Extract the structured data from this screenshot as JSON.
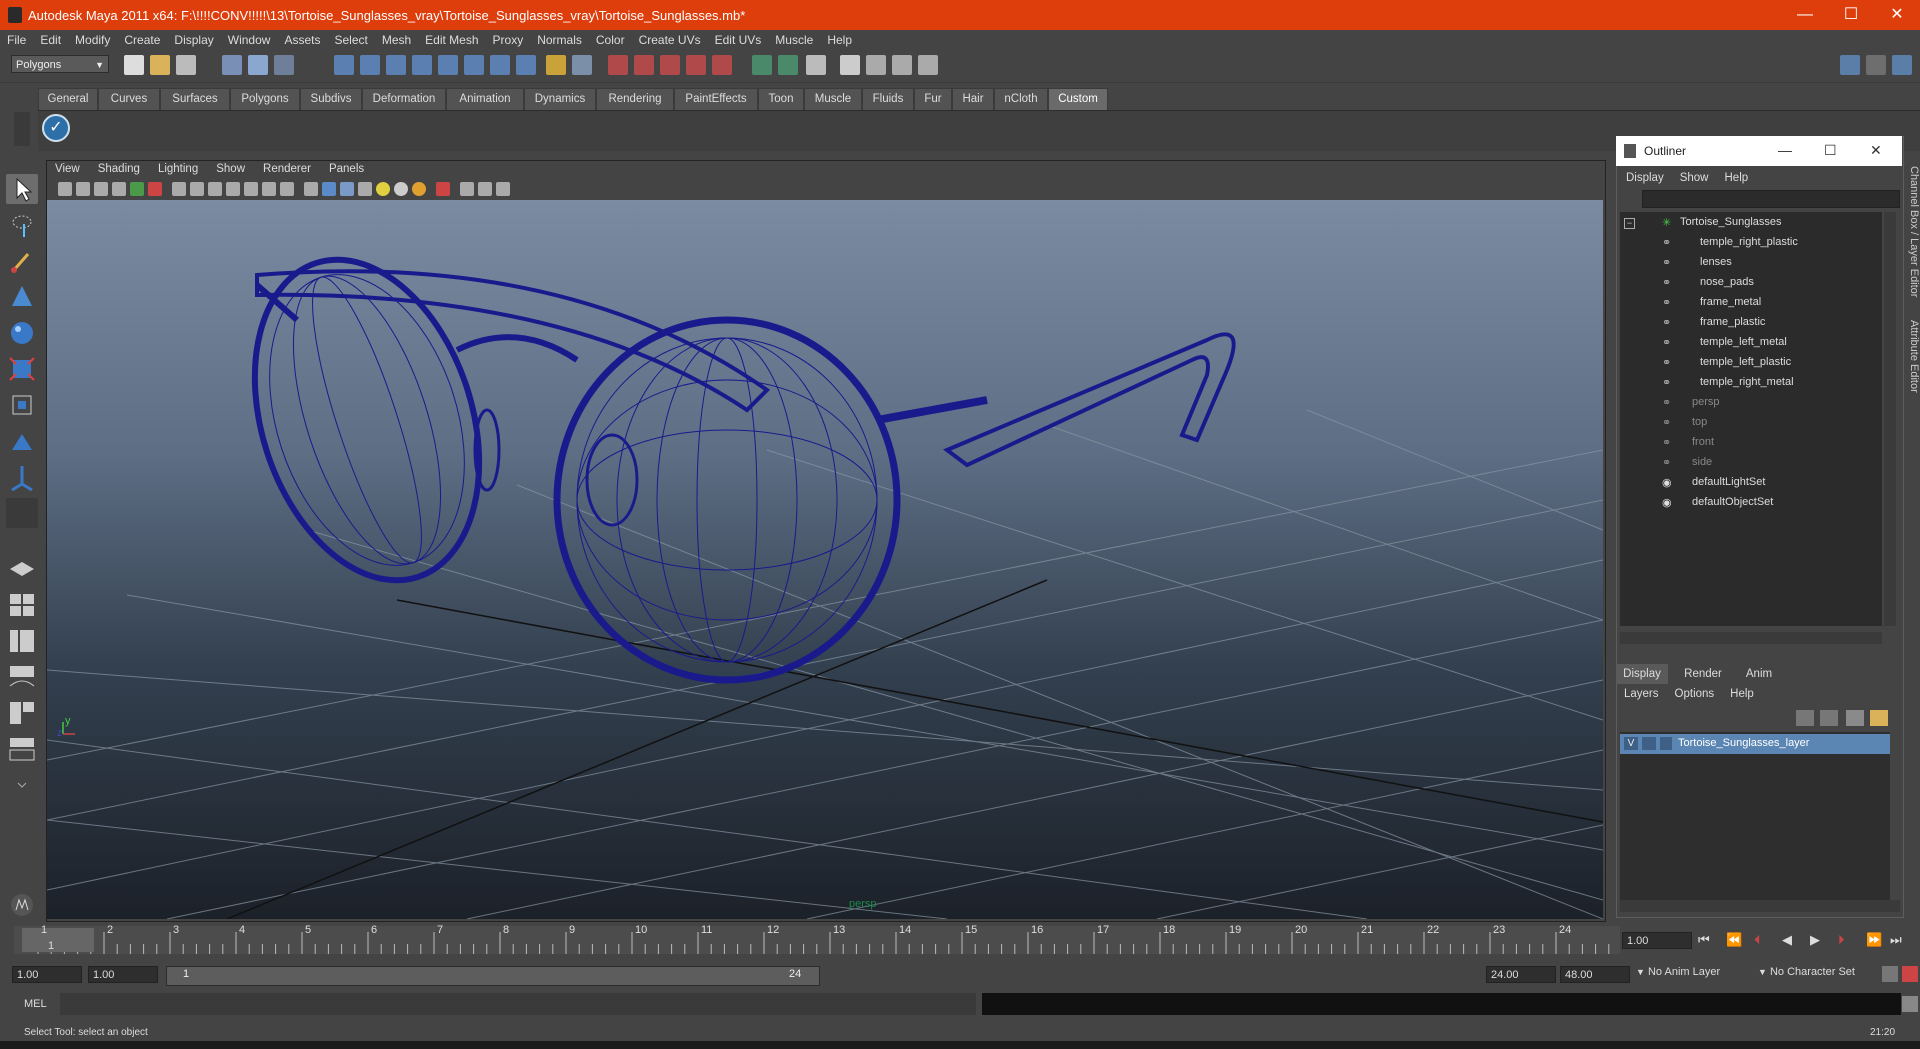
{
  "window": {
    "title": "Autodesk Maya 2011 x64: F:\\!!!!CONV!!!!!\\13\\Tortoise_Sunglasses_vray\\Tortoise_Sunglasses_vray\\Tortoise_Sunglasses.mb*",
    "minimize": "—",
    "maximize": "☐",
    "close": "✕"
  },
  "menubar": [
    "File",
    "Edit",
    "Modify",
    "Create",
    "Display",
    "Window",
    "Assets",
    "Select",
    "Mesh",
    "Edit Mesh",
    "Proxy",
    "Normals",
    "Color",
    "Create UVs",
    "Edit UVs",
    "Muscle",
    "Help"
  ],
  "toolbar": {
    "mode": "Polygons"
  },
  "shelf_tabs": [
    "General",
    "Curves",
    "Surfaces",
    "Polygons",
    "Subdivs",
    "Deformation",
    "Animation",
    "Dynamics",
    "Rendering",
    "PaintEffects",
    "Toon",
    "Muscle",
    "Fluids",
    "Fur",
    "Hair",
    "nCloth",
    "Custom"
  ],
  "shelf_active": "Custom",
  "viewport": {
    "menu": [
      "View",
      "Shading",
      "Lighting",
      "Show",
      "Renderer",
      "Panels"
    ],
    "camera_label": "persp",
    "wire_color": "#1a1a8c"
  },
  "outliner": {
    "title": "Outliner",
    "menu": [
      "Display",
      "Show",
      "Help"
    ],
    "root": "Tortoise_Sunglasses",
    "children": [
      "temple_right_plastic",
      "lenses",
      "nose_pads",
      "frame_metal",
      "frame_plastic",
      "temple_left_metal",
      "temple_left_plastic",
      "temple_right_metal"
    ],
    "cameras": [
      "persp",
      "top",
      "front",
      "side"
    ],
    "sets": [
      "defaultLightSet",
      "defaultObjectSet"
    ]
  },
  "layer_editor": {
    "tabs": [
      "Display",
      "Render",
      "Anim"
    ],
    "active_tab": "Display",
    "menu": [
      "Layers",
      "Options",
      "Help"
    ],
    "layer_visible": "V",
    "layer_name": "Tortoise_Sunglasses_layer"
  },
  "side_tabs": [
    "Channel Box / Layer Editor",
    "Attribute Editor"
  ],
  "timeline": {
    "ticks": [
      "1",
      "2",
      "3",
      "4",
      "5",
      "6",
      "7",
      "8",
      "9",
      "10",
      "11",
      "12",
      "13",
      "14",
      "15",
      "16",
      "17",
      "18",
      "19",
      "20",
      "21",
      "22",
      "23",
      "24"
    ],
    "current_frame": "1.00",
    "current_marker": "1"
  },
  "range": {
    "start": "1.00",
    "playback_start": "1.00",
    "slider_start": "1",
    "slider_end": "24",
    "playback_end": "24.00",
    "end": "48.00",
    "anim_layer": "No Anim Layer",
    "char_set": "No Character Set"
  },
  "command": {
    "label": "MEL",
    "value": ""
  },
  "help_line": "Select Tool: select an object",
  "clock": "21:20"
}
